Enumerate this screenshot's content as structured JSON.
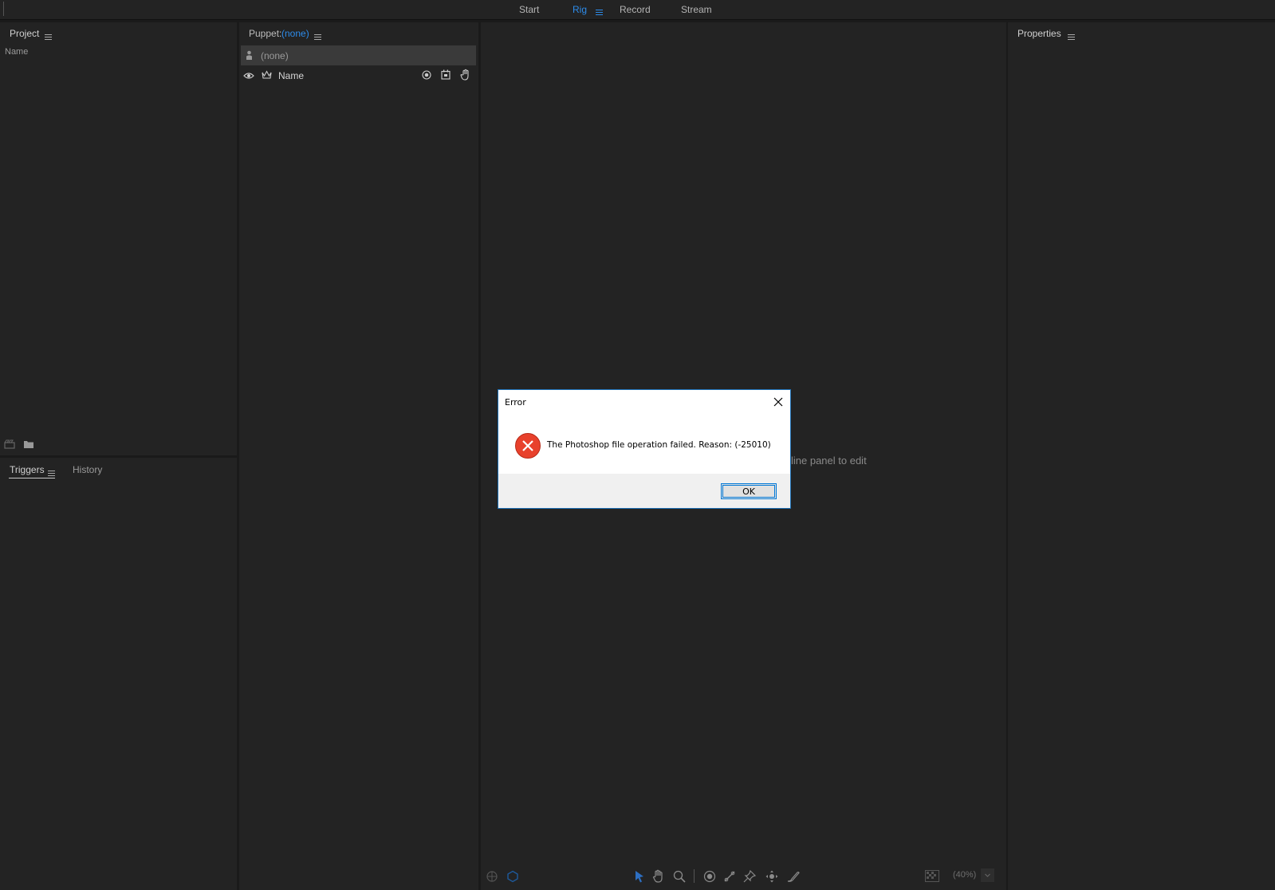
{
  "workspace_tabs": [
    {
      "label": "Start"
    },
    {
      "label": "Rig",
      "active": true
    },
    {
      "label": "Record"
    },
    {
      "label": "Stream"
    }
  ],
  "project": {
    "title": "Project",
    "column_name": "Name"
  },
  "bottom_tabs": {
    "triggers": "Triggers",
    "history": "History"
  },
  "puppet": {
    "label": "Puppet:",
    "value": "(none)",
    "dropdown": "(none)",
    "layer_column": "Name"
  },
  "properties": {
    "title": "Properties"
  },
  "stage": {
    "hint": "line panel to edit",
    "zoom": "(40%)"
  },
  "dialog": {
    "title": "Error",
    "message": "The Photoshop file operation failed. Reason:  (-25010)",
    "ok_label": "OK",
    "icon": "error-icon"
  },
  "colors": {
    "accent": "#2d8ceb",
    "panel": "#232323",
    "background": "#1a1a1a",
    "error": "#e8412c"
  }
}
